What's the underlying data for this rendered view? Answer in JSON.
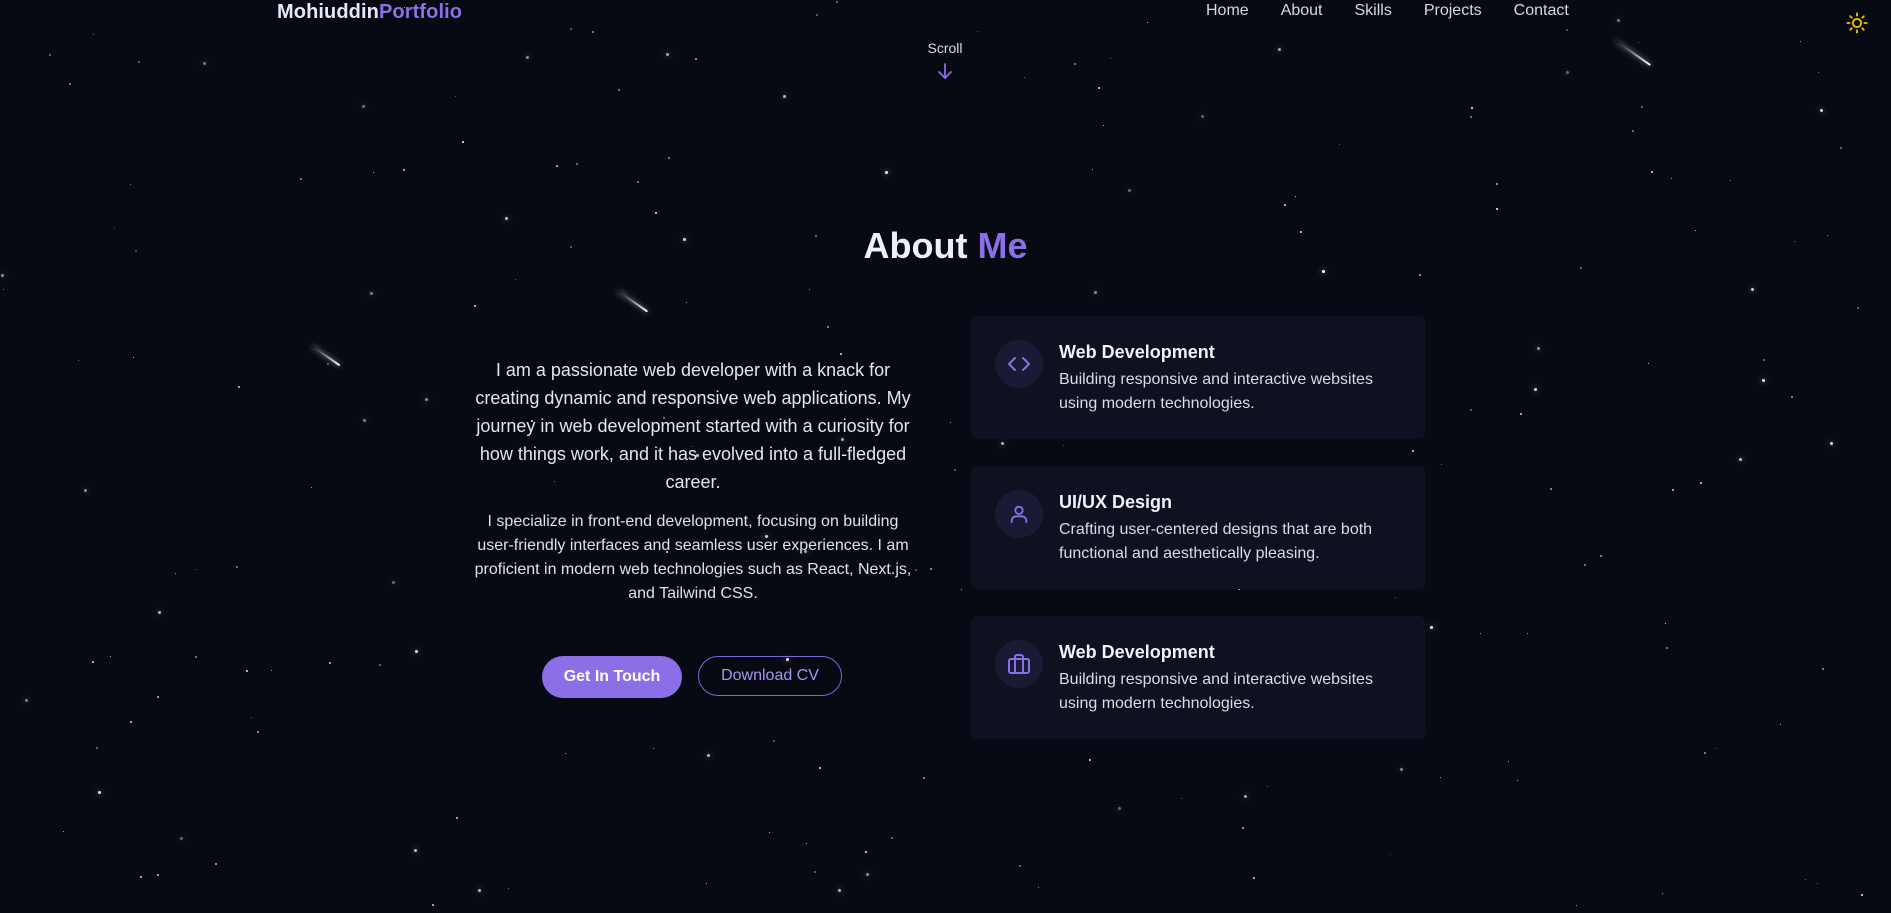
{
  "header": {
    "logo_part1": "Mohiuddin",
    "logo_part2": "Portfolio",
    "nav": [
      "Home",
      "About",
      "Skills",
      "Projects",
      "Contact"
    ],
    "theme_icon": "sun-icon"
  },
  "scroll": {
    "label": "Scroll",
    "icon": "arrow-down-icon"
  },
  "about": {
    "title_part1": "About",
    "title_part2": "Me",
    "paragraph1": "I am a passionate web developer with a knack for creating dynamic and responsive web applications. My journey in web development started with a curiosity for how things work, and it has evolved into a full-fledged career.",
    "paragraph2": "I specialize in front-end development, focusing on building user-friendly interfaces and seamless user experiences. I am proficient in modern web technologies such as React, Next.js, and Tailwind CSS.",
    "primary_button": "Get In Touch",
    "secondary_button": "Download CV",
    "cards": [
      {
        "icon": "code-icon",
        "title": "Web Development",
        "description": "Building responsive and interactive websites using modern technologies."
      },
      {
        "icon": "user-icon",
        "title": "UI/UX Design",
        "description": "Crafting user-centered designs that are both functional and aesthetically pleasing."
      },
      {
        "icon": "briefcase-icon",
        "title": "Web Development",
        "description": "Building responsive and interactive websites using modern technologies."
      }
    ]
  },
  "colors": {
    "background": "#070913",
    "accent": "#8b6fe6",
    "card_background": "#0d1120",
    "sun": "#f5c400"
  }
}
